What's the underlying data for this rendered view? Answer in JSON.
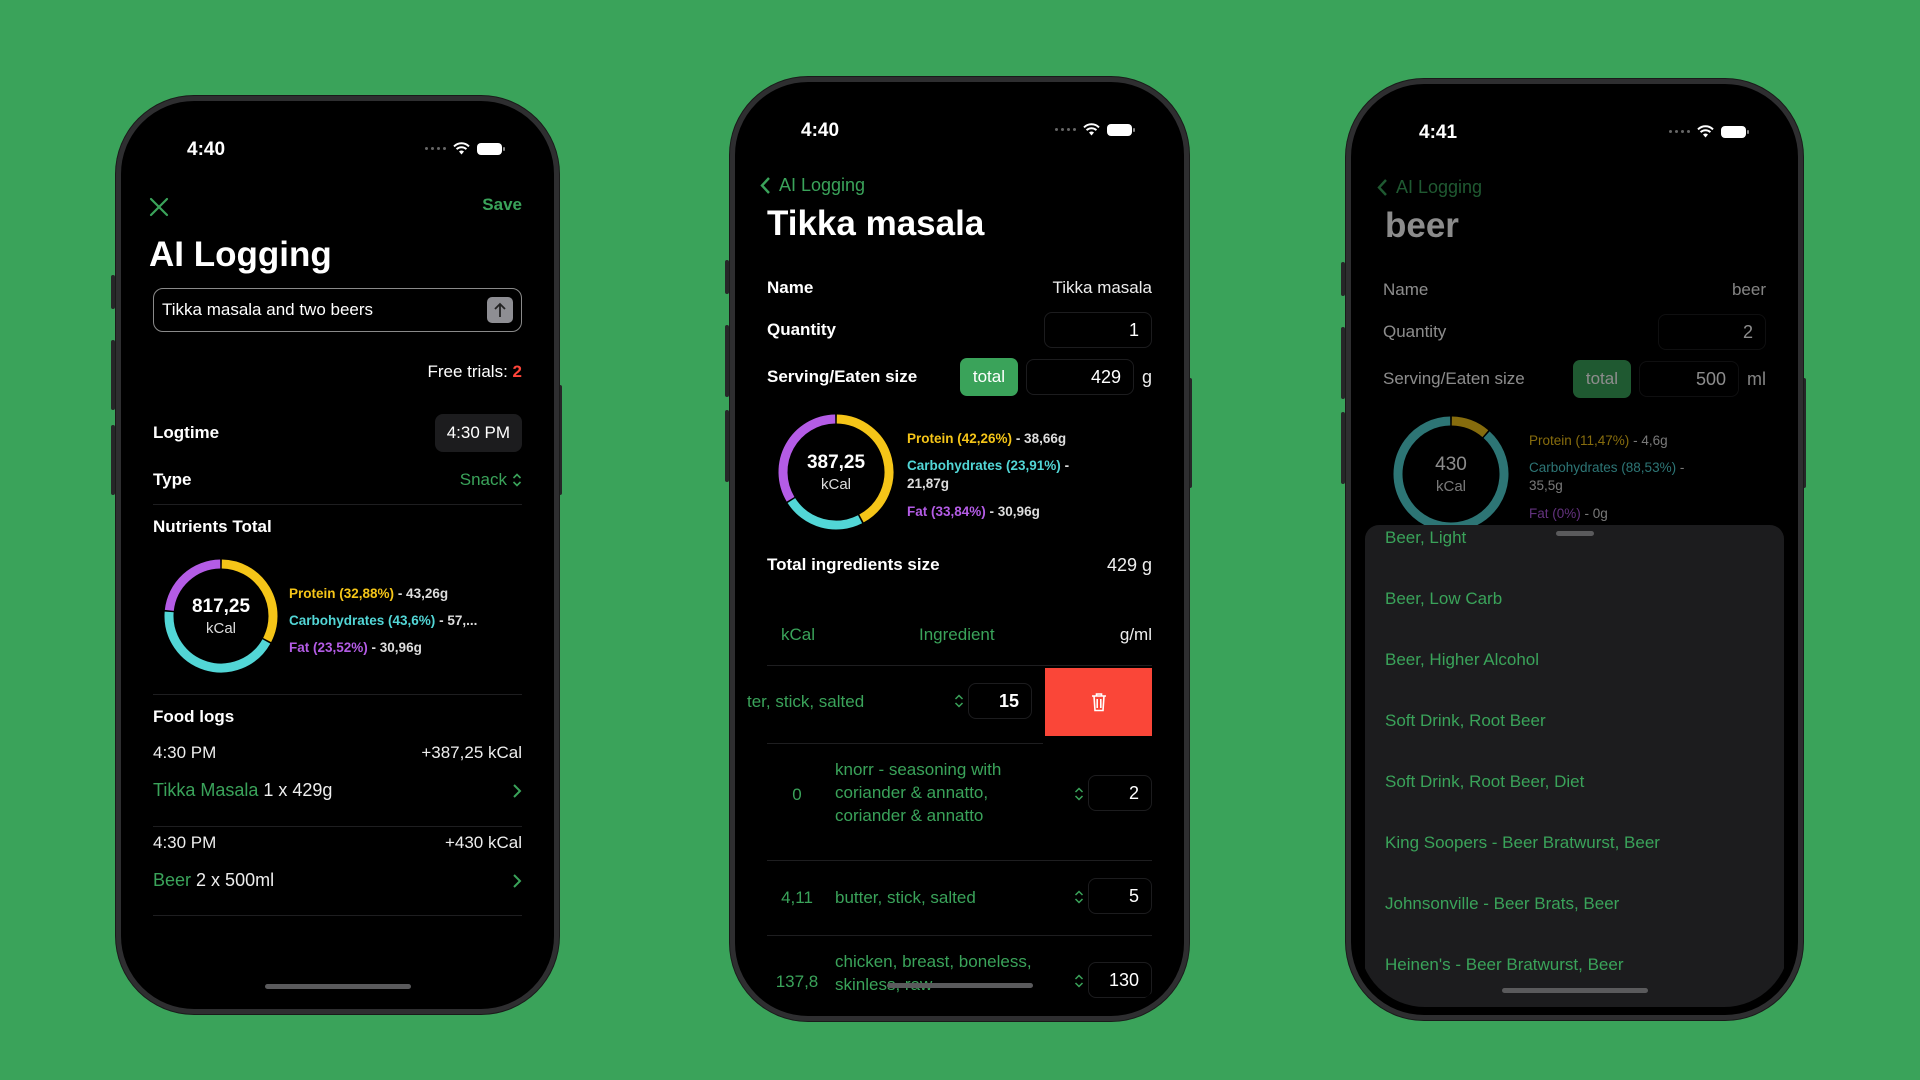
{
  "colors": {
    "background": "#3aa35a",
    "accent": "#3aa35a",
    "protein": "#f5c518",
    "carbohydrates": "#52d6d6",
    "fat": "#b45ce6",
    "delete": "#fa4638",
    "free_trials_count": "#ff453a"
  },
  "status_bar_icons": [
    "signal-dots-icon",
    "wifi-icon",
    "battery-icon"
  ],
  "screen1": {
    "time": "4:40",
    "close_icon": "close-icon",
    "save_label": "Save",
    "title": "AI Logging",
    "prompt_input": {
      "value": "Tikka masala and two beers",
      "submit_icon": "arrow-up-icon"
    },
    "free_trials": {
      "label": "Free trials:",
      "count": "2"
    },
    "logtime": {
      "label": "Logtime",
      "value": "4:30 PM"
    },
    "type": {
      "label": "Type",
      "value": "Snack",
      "icon": "chevron-up-down-icon"
    },
    "nutrients": {
      "label": "Nutrients Total",
      "kcal": "817,25",
      "unit": "kCal",
      "protein": {
        "label": "Protein (32,88%)",
        "value": "- 43,26g",
        "percent": 32.88
      },
      "carbs": {
        "label": "Carbohydrates (43,6%)",
        "value": "- 57,...",
        "percent": 43.6
      },
      "fat": {
        "label": "Fat (23,52%)",
        "value": "- 30,96g",
        "percent": 23.52
      }
    },
    "food_logs": {
      "label": "Food logs",
      "items": [
        {
          "time": "4:30 PM",
          "kcal": "+387,25 kCal",
          "name": "Tikka Masala",
          "portion": "1 x 429g"
        },
        {
          "time": "4:30 PM",
          "kcal": "+430 kCal",
          "name": "Beer",
          "portion": "2 x 500ml"
        }
      ]
    }
  },
  "screen2": {
    "time": "4:40",
    "back_label": "AI Logging",
    "title": "Tikka masala",
    "name": {
      "label": "Name",
      "value": "Tikka masala"
    },
    "quantity": {
      "label": "Quantity",
      "value": "1"
    },
    "serving": {
      "label": "Serving/Eaten size",
      "chip": "total",
      "value": "429",
      "unit": "g"
    },
    "nutrients": {
      "kcal": "387,25",
      "unit": "kCal",
      "protein": {
        "label": "Protein (42,26%)",
        "value": "- 38,66g",
        "percent": 42.26
      },
      "carbs": {
        "label": "Carbohydrates (23,91%)",
        "value": "- 21,87g",
        "percent": 23.91
      },
      "fat": {
        "label": "Fat (33,84%)",
        "value": "- 30,96g",
        "percent": 33.84
      }
    },
    "total_size": {
      "label": "Total ingredients size",
      "value": "429 g"
    },
    "table": {
      "headers": {
        "kcal": "kCal",
        "ingredient": "Ingredient",
        "amount": "g/ml"
      },
      "swiped_row": {
        "ingredient": "ter, stick, salted",
        "amount": "15",
        "delete_icon": "trash-icon"
      },
      "rows": [
        {
          "kcal": "0",
          "ingredient": "knorr - seasoning with coriander & annatto, coriander & annatto",
          "amount": "2"
        },
        {
          "kcal": "4,11",
          "ingredient": "butter, stick, salted",
          "amount": "5"
        },
        {
          "kcal": "137,8",
          "ingredient": "chicken, breast, boneless, skinless, raw",
          "amount": "130"
        }
      ]
    }
  },
  "screen3": {
    "time": "4:41",
    "back_label": "AI Logging",
    "title": "beer",
    "name": {
      "label": "Name",
      "value": "beer"
    },
    "quantity": {
      "label": "Quantity",
      "value": "2"
    },
    "serving": {
      "label": "Serving/Eaten size",
      "chip": "total",
      "value": "500",
      "unit": "ml"
    },
    "nutrients": {
      "kcal": "430",
      "unit": "kCal",
      "protein": {
        "label": "Protein (11,47%)",
        "value": "- 4,6g",
        "percent": 11.47
      },
      "carbs": {
        "label": "Carbohydrates (88,53%)",
        "value": "- 35,5g",
        "percent": 88.53
      },
      "fat": {
        "label": "Fat (0%)",
        "value": "- 0g",
        "percent": 0
      }
    },
    "suggestions": [
      "Beer, Light",
      "Beer, Low Carb",
      "Beer, Higher Alcohol",
      "Soft Drink, Root Beer",
      "Soft Drink, Root Beer, Diet",
      "King Soopers - Beer Bratwurst, Beer",
      "Johnsonville - Beer Brats, Beer",
      "Heinen's - Beer Bratwurst, Beer"
    ]
  }
}
